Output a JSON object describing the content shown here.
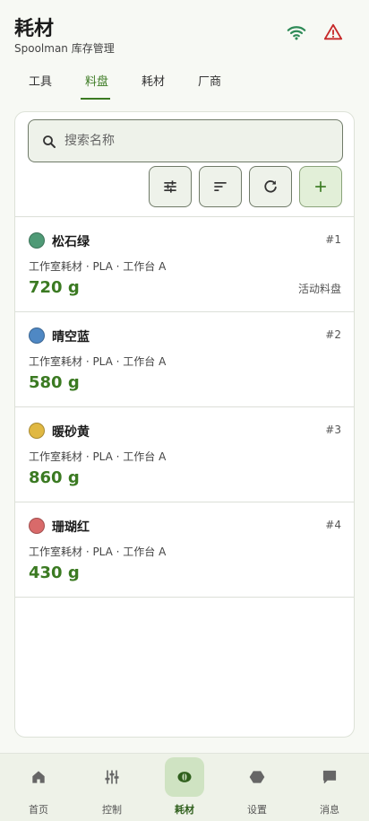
{
  "header": {
    "title": "耗材",
    "subtitle": "Spoolman 库存管理",
    "icons": [
      "wifi-icon",
      "warning-icon"
    ],
    "colors": {
      "wifi": "#2e8b57",
      "warning": "#c62828"
    }
  },
  "tabs": [
    {
      "label": "工具",
      "active": false
    },
    {
      "label": "料盘",
      "active": true
    },
    {
      "label": "耗材",
      "active": false
    },
    {
      "label": "厂商",
      "active": false
    }
  ],
  "search": {
    "placeholder": "搜索名称",
    "value": ""
  },
  "toolbar": {
    "buttons": [
      "filter-icon",
      "sort-icon",
      "refresh-icon",
      "add-icon"
    ]
  },
  "spools": [
    {
      "color": "#4f9a76",
      "name": "松石绿",
      "id": "#1",
      "meta": "工作室耗材 · PLA · 工作台 A",
      "weight": "720 g",
      "tag": "活动料盘"
    },
    {
      "color": "#4f88c4",
      "name": "晴空蓝",
      "id": "#2",
      "meta": "工作室耗材 · PLA · 工作台 A",
      "weight": "580 g",
      "tag": ""
    },
    {
      "color": "#e0b842",
      "name": "暖砂黄",
      "id": "#3",
      "meta": "工作室耗材 · PLA · 工作台 A",
      "weight": "860 g",
      "tag": ""
    },
    {
      "color": "#d96a6a",
      "name": "珊瑚红",
      "id": "#4",
      "meta": "工作室耗材 · PLA · 工作台 A",
      "weight": "430 g",
      "tag": ""
    }
  ],
  "bottom_nav": [
    {
      "label": "首页",
      "icon": "home-icon",
      "active": false
    },
    {
      "label": "控制",
      "icon": "sliders-icon",
      "active": false
    },
    {
      "label": "耗材",
      "icon": "spool-icon",
      "active": true
    },
    {
      "label": "设置",
      "icon": "hexagon-icon",
      "active": false
    },
    {
      "label": "消息",
      "icon": "chat-icon",
      "active": false
    }
  ],
  "accent": "#3b7a22"
}
